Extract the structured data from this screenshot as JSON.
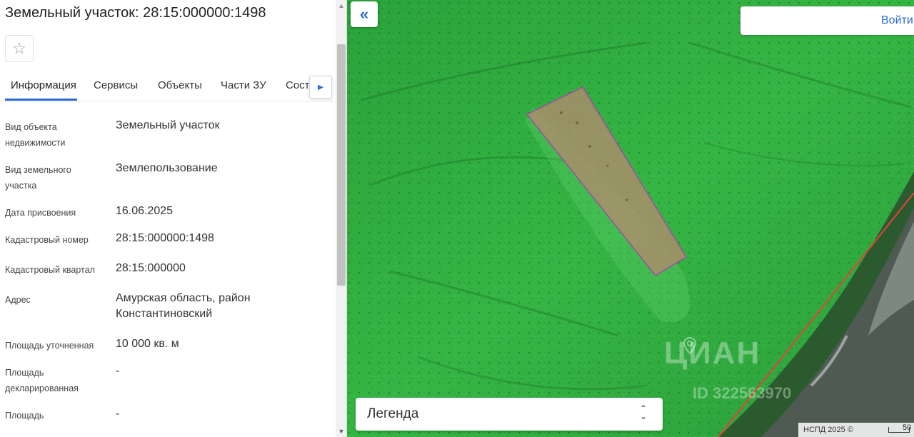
{
  "panel": {
    "title": "Земельный участок: 28:15:000000:1498",
    "favorite_icon": "star-outline-icon",
    "tabs": [
      {
        "label": "Информация"
      },
      {
        "label": "Сервисы"
      },
      {
        "label": "Объекты"
      },
      {
        "label": "Части ЗУ"
      },
      {
        "label": "Соста"
      }
    ],
    "tabs_scroll_icon": "triangle-right-icon",
    "rows": [
      {
        "label": "Вид объекта недвижимости",
        "value": "Земельный участок"
      },
      {
        "label": "Вид земельного участка",
        "value": "Землепользование"
      },
      {
        "label": "Дата присвоения",
        "value": "16.06.2025"
      },
      {
        "label": "Кадастровый номер",
        "value": "28:15:000000:1498"
      },
      {
        "label": "Кадастровый квартал",
        "value": "28:15:000000"
      },
      {
        "label": "Адрес",
        "value": "Амурская область, район Константиновский"
      },
      {
        "label": "Площадь уточненная",
        "value": "10 000 кв. м"
      },
      {
        "label": "Площадь декларированная",
        "value": "-"
      },
      {
        "label": "Площадь",
        "value": "-"
      }
    ]
  },
  "map": {
    "collapse_icon": "double-chevron-left-icon",
    "login_label": "Войти",
    "legend_label": "Легенда",
    "legend_toggle_icon": "chevron-up-down-icon",
    "attribution": "НСПД 2025 ©",
    "scale_label": "50",
    "watermark": "ЦИАН",
    "watermark_id": "ID 322563970",
    "colors": {
      "parcel_fill": "#b48a6e",
      "parcel_stroke": "#a14aa8",
      "boundary_line": "#e8423a",
      "accent": "#2b6ad1"
    }
  }
}
